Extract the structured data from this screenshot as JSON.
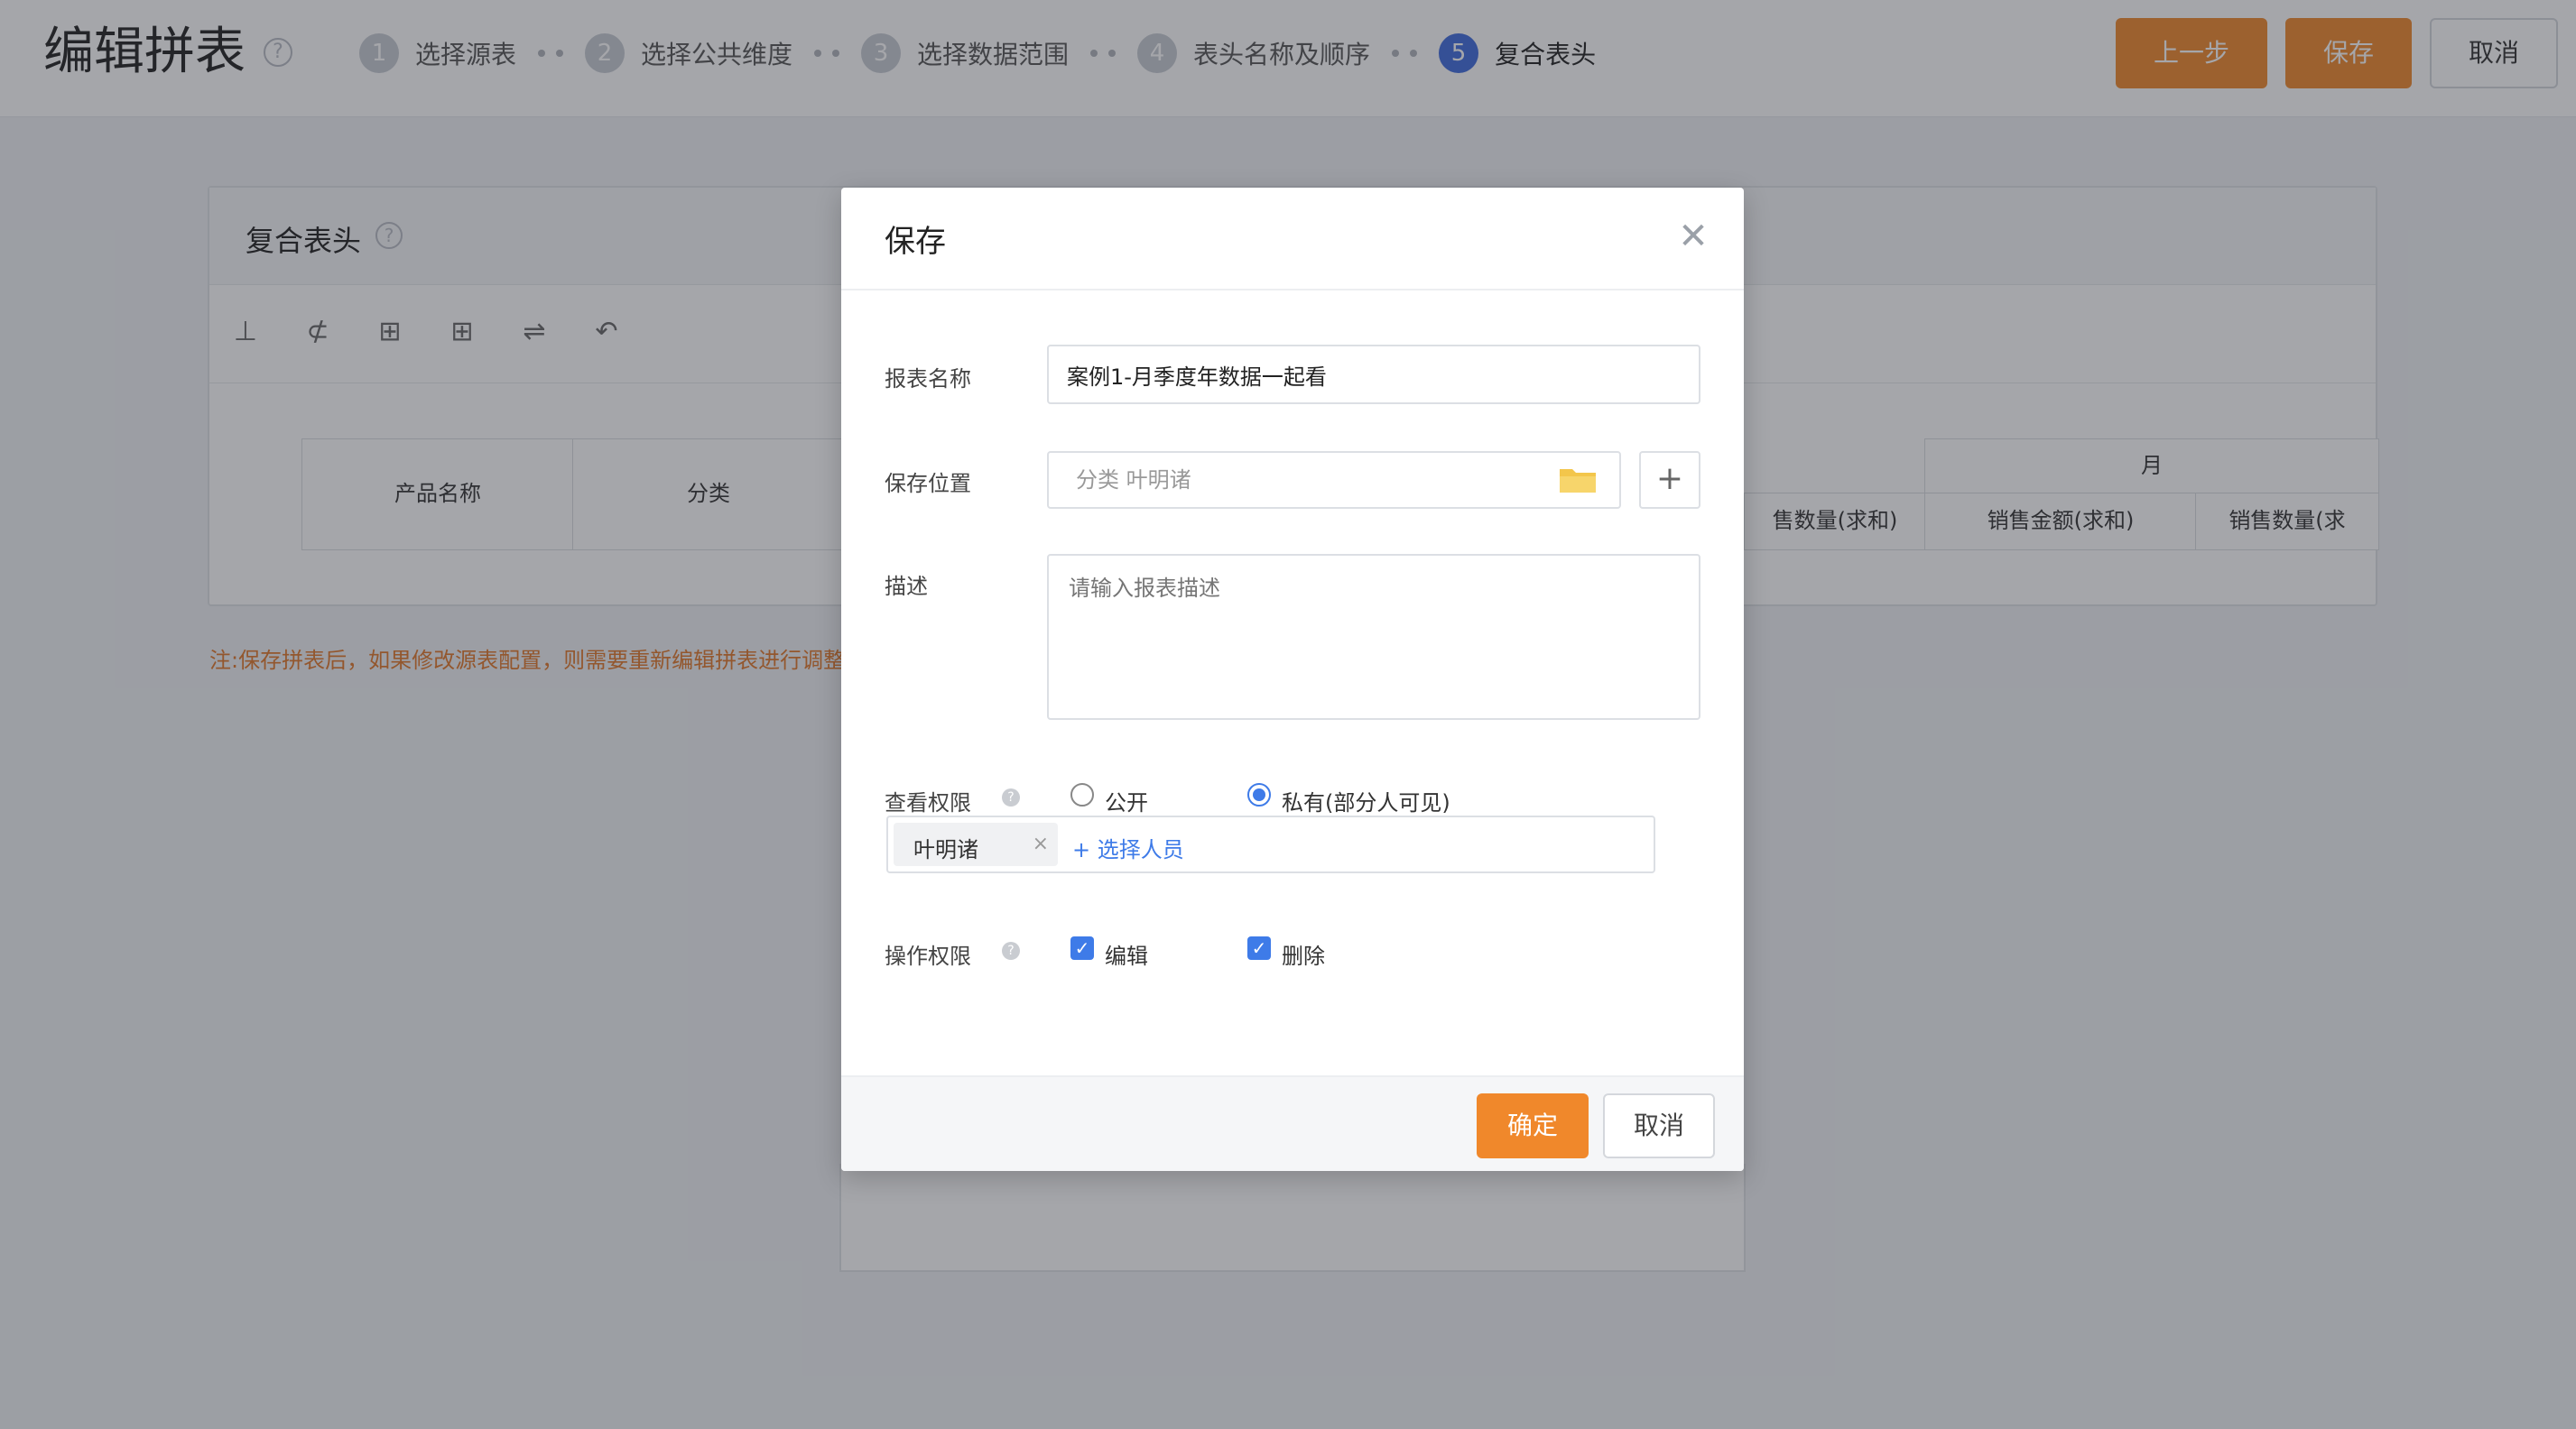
{
  "header": {
    "title": "编辑拼表",
    "help_icon": "question-circle-icon",
    "steps": [
      {
        "num": "1",
        "label": "选择源表"
      },
      {
        "num": "2",
        "label": "选择公共维度"
      },
      {
        "num": "3",
        "label": "选择数据范围"
      },
      {
        "num": "4",
        "label": "表头名称及顺序"
      },
      {
        "num": "5",
        "label": "复合表头"
      }
    ],
    "active_step": 5,
    "buttons": {
      "prev": "上一步",
      "save": "保存",
      "cancel": "取消"
    }
  },
  "panel": {
    "title": "复合表头",
    "toolbar_icons": [
      "insert-row-icon",
      "delete-row-icon",
      "merge-cells-icon",
      "split-cells-icon",
      "swap-icon",
      "undo-icon"
    ],
    "columns": {
      "product_name": "产品名称",
      "category": "分类",
      "month": "月",
      "sales_qty_sum": "售数量(求和)",
      "sales_amount_sum": "销售金额(求和)",
      "sales_qty_sum_2": "销售数量(求"
    },
    "note": "注:保存拼表后，如果修改源表配置，则需要重新编辑拼表进行调整"
  },
  "modal": {
    "title": "保存",
    "fields": {
      "name_label": "报表名称",
      "name_value": "案例1-月季度年数据一起看",
      "location_label": "保存位置",
      "location_value": "分类 叶明诸",
      "desc_label": "描述",
      "desc_placeholder": "请输入报表描述",
      "view_label": "查看权限",
      "view_public": "公开",
      "view_private": "私有(部分人可见)",
      "view_selected": "private",
      "person_tag": "叶明诸",
      "add_person": "+ 选择人员",
      "op_label": "操作权限",
      "op_edit": "编辑",
      "op_delete": "删除",
      "op_edit_checked": true,
      "op_delete_checked": true
    },
    "footer": {
      "confirm": "确定",
      "cancel": "取消"
    }
  },
  "colors": {
    "accent_orange": "#f0882b",
    "active_blue": "#3f6bdc",
    "link_blue": "#3e7be8",
    "note_orange": "#e0782a"
  }
}
